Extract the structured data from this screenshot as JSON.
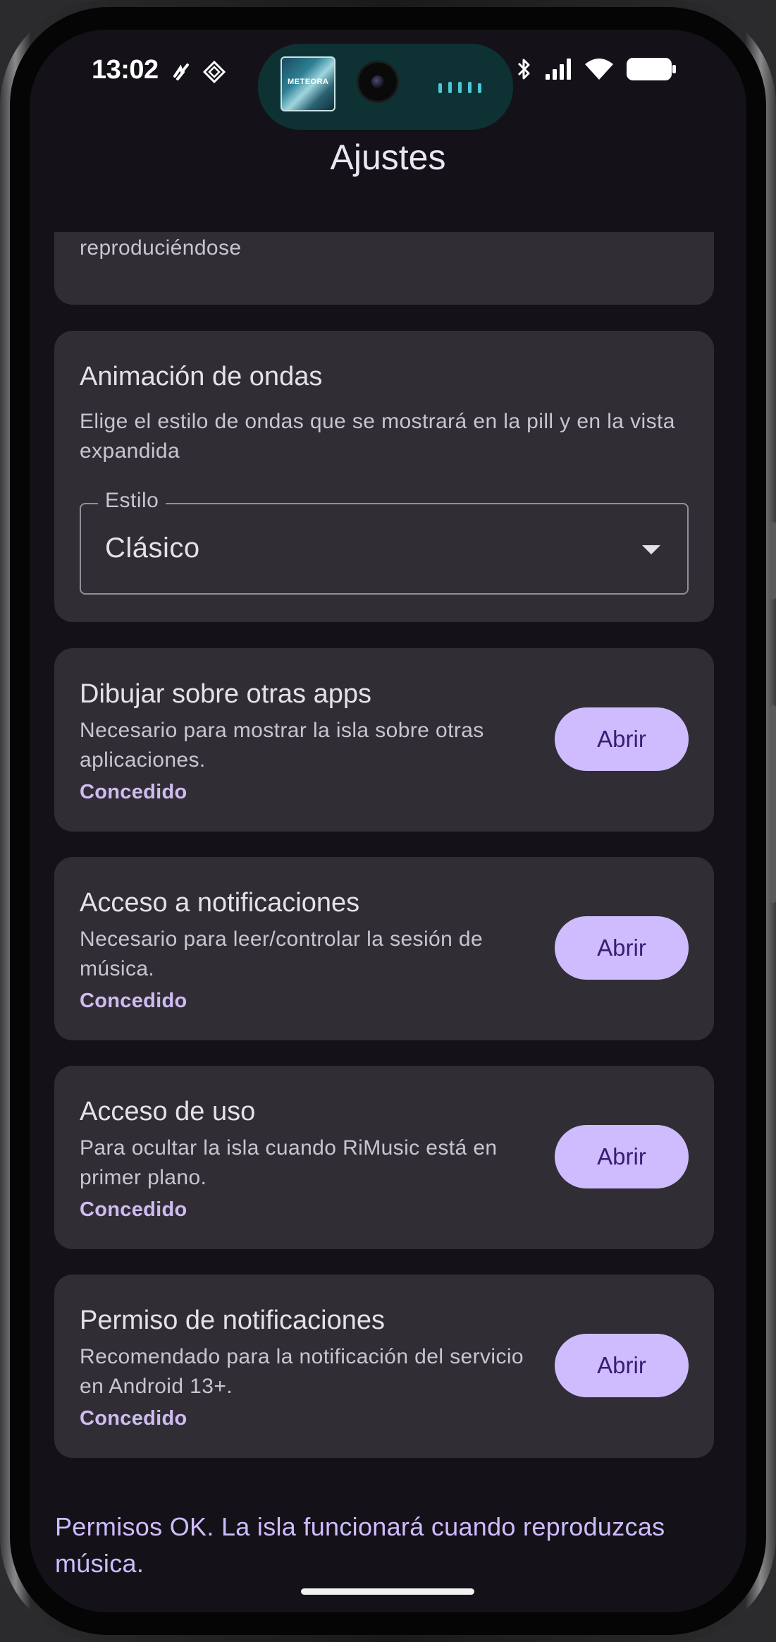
{
  "status_bar": {
    "time": "13:02",
    "album_text": "METEORA"
  },
  "header": {
    "title": "Ajustes"
  },
  "show_island_card": {
    "description": "La isla se mostrará cuando haya música reproduciéndose",
    "toggle_on": true
  },
  "wave_card": {
    "title": "Animación de ondas",
    "description": "Elige el estilo de ondas que se mostrará en la pill y en la vista expandida",
    "select_label": "Estilo",
    "select_value": "Clásico"
  },
  "permissions": [
    {
      "title": "Dibujar sobre otras apps",
      "description": "Necesario para mostrar la isla sobre otras aplicaciones.",
      "status": "Concedido",
      "button": "Abrir"
    },
    {
      "title": "Acceso a notificaciones",
      "description": "Necesario para leer/controlar la sesión de música.",
      "status": "Concedido",
      "button": "Abrir"
    },
    {
      "title": "Acceso de uso",
      "description": "Para ocultar la isla cuando RiMusic está en primer plano.",
      "status": "Concedido",
      "button": "Abrir"
    },
    {
      "title": "Permiso de notificaciones",
      "description": "Recomendado para la notificación del servicio en Android 13+.",
      "status": "Concedido",
      "button": "Abrir"
    }
  ],
  "footer": {
    "status_message": "Permisos OK. La isla funcionará cuando reproduzcas música."
  },
  "colors": {
    "background": "#141218",
    "card": "#302e34",
    "accent": "#cfbcff",
    "accent_text": "#381e72",
    "island": "#0e3133"
  }
}
